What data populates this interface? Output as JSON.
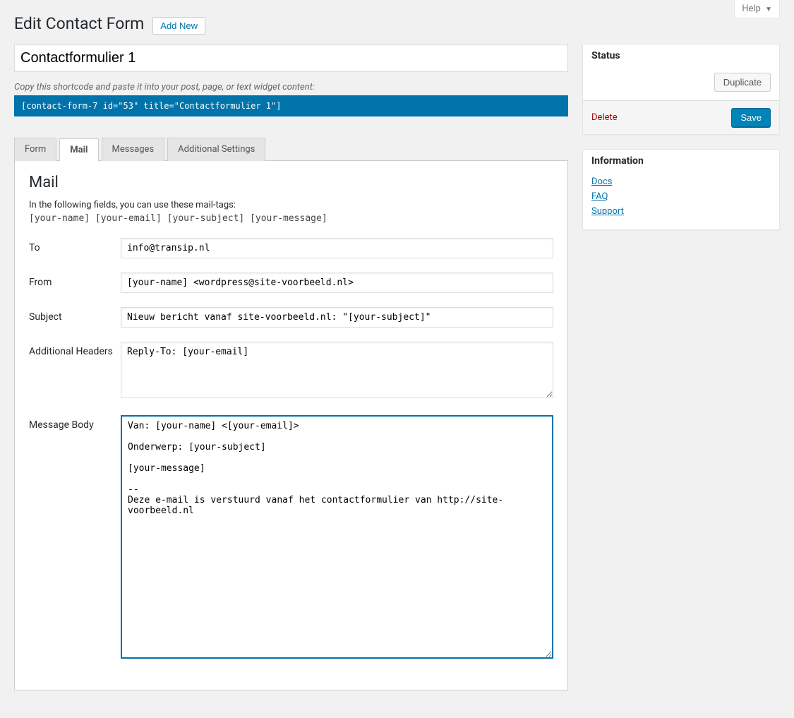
{
  "help": "Help",
  "page_heading": "Edit Contact Form",
  "add_new": "Add New",
  "form_title": "Contactformulier 1",
  "shortcode_hint": "Copy this shortcode and paste it into your post, page, or text widget content:",
  "shortcode": "[contact-form-7 id=\"53\" title=\"Contactformulier 1\"]",
  "tabs": {
    "form": "Form",
    "mail": "Mail",
    "messages": "Messages",
    "additional": "Additional Settings"
  },
  "mail": {
    "section_title": "Mail",
    "intro": "In the following fields, you can use these mail-tags:",
    "tags": "[your-name] [your-email] [your-subject] [your-message]",
    "labels": {
      "to": "To",
      "from": "From",
      "subject": "Subject",
      "headers": "Additional Headers",
      "body": "Message Body"
    },
    "values": {
      "to": "info@transip.nl",
      "from": "[your-name] <wordpress@site-voorbeeld.nl>",
      "subject": "Nieuw bericht vanaf site-voorbeeld.nl: \"[your-subject]\"",
      "headers": "Reply-To: [your-email]",
      "body": "Van: [your-name] <[your-email]>\n\nOnderwerp: [your-subject]\n\n[your-message]\n\n--\nDeze e-mail is verstuurd vanaf het contactformulier van http://site-voorbeeld.nl"
    }
  },
  "sidebar": {
    "status_title": "Status",
    "duplicate": "Duplicate",
    "delete": "Delete",
    "save": "Save",
    "info_title": "Information",
    "links": {
      "docs": "Docs",
      "faq": "FAQ",
      "support": "Support"
    }
  }
}
